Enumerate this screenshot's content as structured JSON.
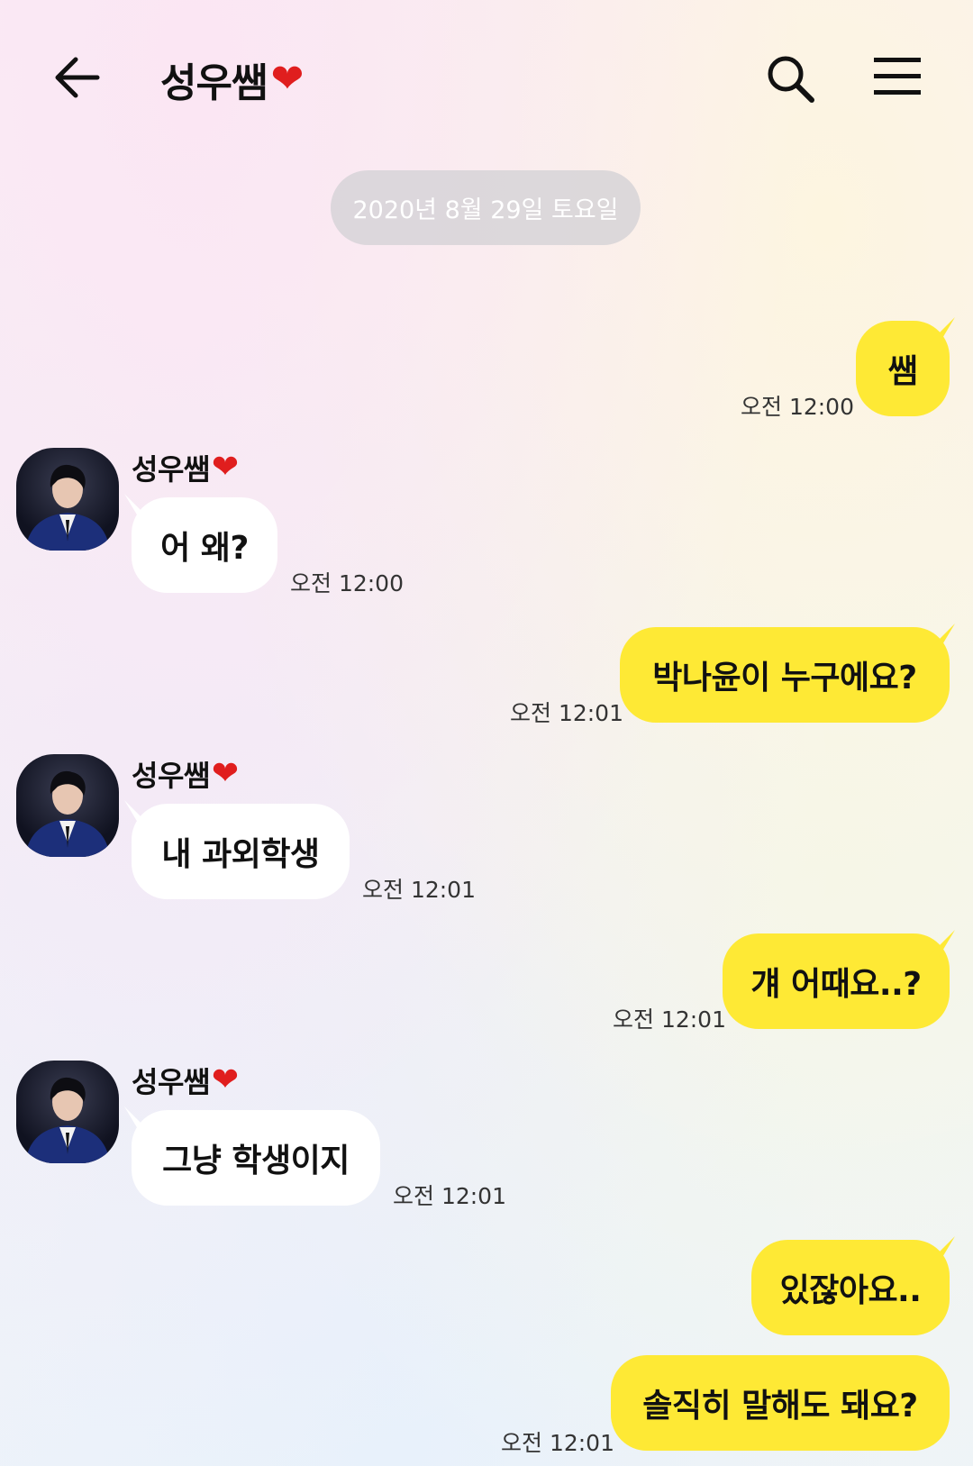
{
  "header": {
    "title": "성우쌤",
    "title_emoji": "❤"
  },
  "date_divider": "2020년 8월 29일 토요일",
  "contact": {
    "name": "성우쌤",
    "name_emoji": "❤"
  },
  "messages": [
    {
      "side": "me",
      "text": "쌤",
      "time": "오전 12:00"
    },
    {
      "side": "them",
      "text": "어 왜?",
      "time": "오전 12:00"
    },
    {
      "side": "me",
      "text": "박나윤이 누구에요?",
      "time": "오전 12:01"
    },
    {
      "side": "them",
      "text": "내 과외학생",
      "time": "오전 12:01"
    },
    {
      "side": "me",
      "text": "걔 어때요..?",
      "time": "오전 12:01"
    },
    {
      "side": "them",
      "text": "그냥 학생이지",
      "time": "오전 12:01"
    },
    {
      "side": "me",
      "text": "있잖아요..",
      "time": ""
    },
    {
      "side": "me",
      "text": "솔직히 말해도 돼요?",
      "time": "오전 12:01"
    }
  ],
  "colors": {
    "my_bubble": "#fee935",
    "their_bubble": "#ffffff",
    "heart": "#e01e1e"
  },
  "icons": {
    "back": "arrow-left-icon",
    "search": "search-icon",
    "menu": "hamburger-menu-icon"
  }
}
